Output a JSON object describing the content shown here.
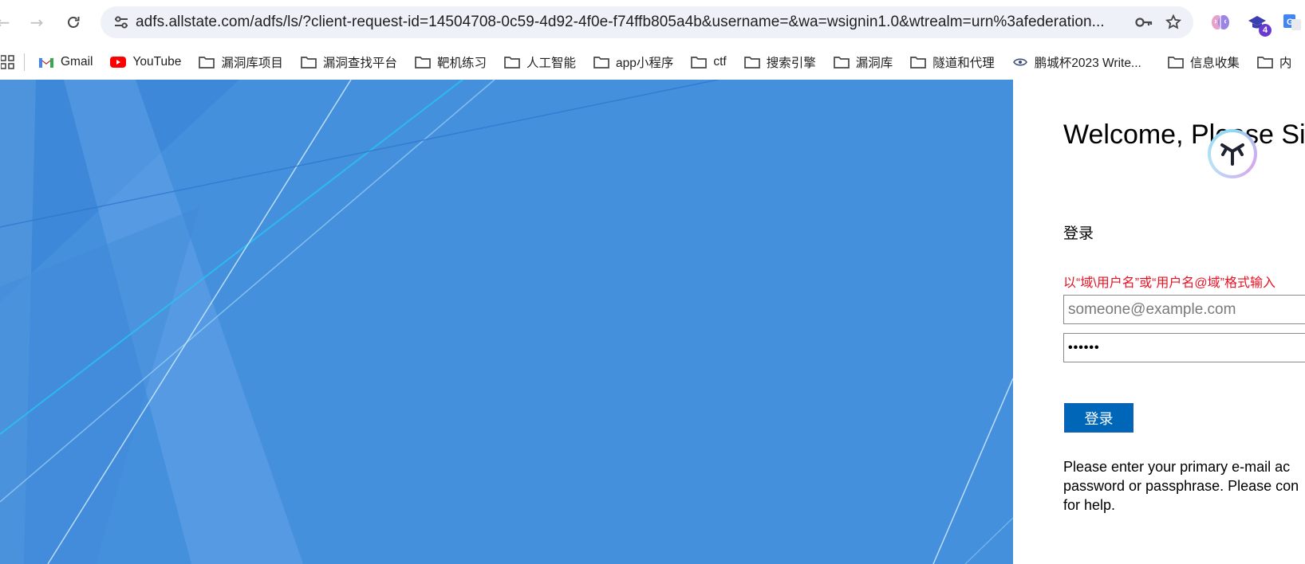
{
  "browser": {
    "url": "adfs.allstate.com/adfs/ls/?client-request-id=14504708-0c59-4d92-4f0e-f74ffb805a4b&username=&wa=wsignin1.0&wtrealm=urn%3afederation...",
    "extension_badge": "4"
  },
  "bookmarks": [
    {
      "label": "Gmail",
      "icon": "gmail-icon"
    },
    {
      "label": "YouTube",
      "icon": "youtube-icon"
    },
    {
      "label": "漏洞库项目",
      "icon": "folder-icon"
    },
    {
      "label": "漏洞查找平台",
      "icon": "folder-icon"
    },
    {
      "label": "靶机练习",
      "icon": "folder-icon"
    },
    {
      "label": "人工智能",
      "icon": "folder-icon"
    },
    {
      "label": "app小程序",
      "icon": "folder-icon"
    },
    {
      "label": "ctf",
      "icon": "folder-icon"
    },
    {
      "label": "搜索引擎",
      "icon": "folder-icon"
    },
    {
      "label": "漏洞库",
      "icon": "folder-icon"
    },
    {
      "label": "隧道和代理",
      "icon": "folder-icon"
    },
    {
      "label": "鹏城杯2023 Write...",
      "icon": "eye-icon"
    },
    {
      "label": "信息收集",
      "icon": "folder-icon"
    },
    {
      "label": "内",
      "icon": "folder-icon"
    }
  ],
  "signin": {
    "title": "Welcome, Please Sig",
    "section_label": "登录",
    "error_text": "以“域\\用户名”或“用户名@域”格式输入",
    "username_placeholder": "someone@example.com",
    "username_value": "",
    "password_value": "••••••",
    "submit_label": "登录",
    "help_line1": "Please enter your primary e-mail ac",
    "help_line2": "password or passphrase. Please con",
    "help_line3": "for help."
  },
  "colors": {
    "illustration_bg": "#4590dd",
    "button": "#0067b8",
    "error": "#e81123"
  }
}
